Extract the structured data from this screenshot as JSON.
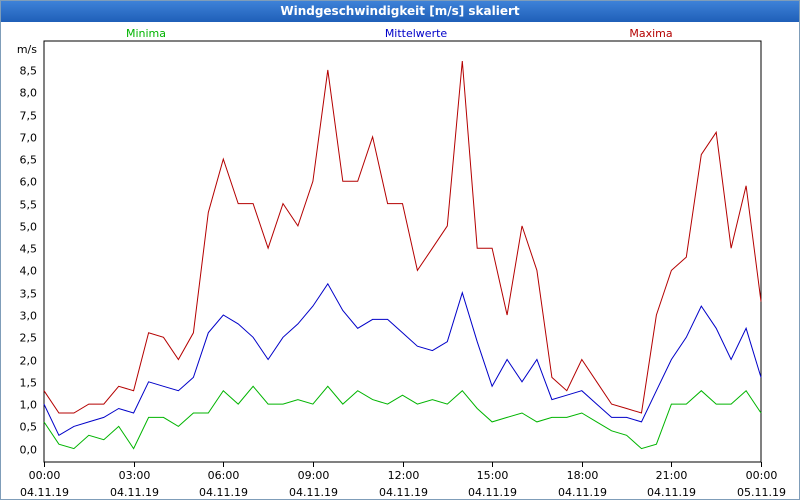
{
  "window": {
    "title": "Windgeschwindigkeit [m/s] skaliert"
  },
  "colors": {
    "min": "#00b400",
    "mean": "#0000c8",
    "max": "#b40000",
    "grid": "#000000"
  },
  "chart_data": {
    "type": "line",
    "title": "Windgeschwindigkeit [m/s] skaliert",
    "ylabel": "m/s",
    "ylim": [
      -0.3,
      9.15
    ],
    "xlim": [
      0,
      24
    ],
    "yticks": [
      "0,0",
      "0,5",
      "1,0",
      "1,5",
      "2,0",
      "2,5",
      "3,0",
      "3,5",
      "4,0",
      "4,5",
      "5,0",
      "5,5",
      "6,0",
      "6,5",
      "7,0",
      "7,5",
      "8,0",
      "8,5"
    ],
    "ytick_values": [
      0,
      0.5,
      1,
      1.5,
      2,
      2.5,
      3,
      3.5,
      4,
      4.5,
      5,
      5.5,
      6,
      6.5,
      7,
      7.5,
      8,
      8.5
    ],
    "xtick_times": [
      "00:00",
      "03:00",
      "06:00",
      "09:00",
      "12:00",
      "15:00",
      "18:00",
      "21:00",
      "00:00"
    ],
    "xtick_dates": [
      "04.11.19",
      "04.11.19",
      "04.11.19",
      "04.11.19",
      "04.11.19",
      "04.11.19",
      "04.11.19",
      "04.11.19",
      "05.11.19"
    ],
    "xtick_values": [
      0,
      3,
      6,
      9,
      12,
      15,
      18,
      21,
      24
    ],
    "grid": true,
    "legend_position": "top",
    "series": [
      {
        "name": "Minima",
        "color": "#00b400",
        "x": [
          0,
          0.5,
          1,
          1.5,
          2,
          2.5,
          3,
          3.5,
          4,
          4.5,
          5,
          5.5,
          6,
          6.5,
          7,
          7.5,
          8,
          8.5,
          9,
          9.5,
          10,
          10.5,
          11,
          11.5,
          12,
          12.5,
          13,
          13.5,
          14,
          14.5,
          15,
          15.5,
          16,
          16.5,
          17,
          17.5,
          18,
          18.5,
          19,
          19.5,
          20,
          20.5,
          21,
          21.5,
          22,
          22.5,
          23,
          23.5,
          24
        ],
        "values": [
          0.6,
          0.1,
          0.0,
          0.3,
          0.2,
          0.5,
          0.0,
          0.7,
          0.7,
          0.5,
          0.8,
          0.8,
          1.3,
          1.0,
          1.4,
          1.0,
          1.0,
          1.1,
          1.0,
          1.4,
          1.0,
          1.3,
          1.1,
          1.0,
          1.2,
          1.0,
          1.1,
          1.0,
          1.3,
          0.9,
          0.6,
          0.7,
          0.8,
          0.6,
          0.7,
          0.7,
          0.8,
          0.6,
          0.4,
          0.3,
          0.0,
          0.1,
          1.0,
          1.0,
          1.3,
          1.0,
          1.0,
          1.3,
          0.8
        ]
      },
      {
        "name": "Mittelwerte",
        "color": "#0000c8",
        "x": [
          0,
          0.5,
          1,
          1.5,
          2,
          2.5,
          3,
          3.5,
          4,
          4.5,
          5,
          5.5,
          6,
          6.5,
          7,
          7.5,
          8,
          8.5,
          9,
          9.5,
          10,
          10.5,
          11,
          11.5,
          12,
          12.5,
          13,
          13.5,
          14,
          14.5,
          15,
          15.5,
          16,
          16.5,
          17,
          17.5,
          18,
          18.5,
          19,
          19.5,
          20,
          20.5,
          21,
          21.5,
          22,
          22.5,
          23,
          23.5,
          24
        ],
        "values": [
          1.0,
          0.3,
          0.5,
          0.6,
          0.7,
          0.9,
          0.8,
          1.5,
          1.4,
          1.3,
          1.6,
          2.6,
          3.0,
          2.8,
          2.5,
          2.0,
          2.5,
          2.8,
          3.2,
          3.7,
          3.1,
          2.7,
          2.9,
          2.9,
          2.6,
          2.3,
          2.2,
          2.4,
          3.5,
          2.4,
          1.4,
          2.0,
          1.5,
          2.0,
          1.1,
          1.2,
          1.3,
          1.0,
          0.7,
          0.7,
          0.6,
          1.3,
          2.0,
          2.5,
          3.2,
          2.7,
          2.0,
          2.7,
          1.6
        ]
      },
      {
        "name": "Maxima",
        "color": "#b40000",
        "x": [
          0,
          0.5,
          1,
          1.5,
          2,
          2.5,
          3,
          3.5,
          4,
          4.5,
          5,
          5.5,
          6,
          6.5,
          7,
          7.5,
          8,
          8.5,
          9,
          9.5,
          10,
          10.5,
          11,
          11.5,
          12,
          12.5,
          13,
          13.5,
          14,
          14.5,
          15,
          15.5,
          16,
          16.5,
          17,
          17.5,
          18,
          18.5,
          19,
          19.5,
          20,
          20.5,
          21,
          21.5,
          22,
          22.5,
          23,
          23.5,
          24
        ],
        "values": [
          1.3,
          0.8,
          0.8,
          1.0,
          1.0,
          1.4,
          1.3,
          2.6,
          2.5,
          2.0,
          2.6,
          5.3,
          6.5,
          5.5,
          5.5,
          4.5,
          5.5,
          5.0,
          6.0,
          8.5,
          6.0,
          6.0,
          7.0,
          5.5,
          5.5,
          4.0,
          4.5,
          5.0,
          8.7,
          4.5,
          4.5,
          3.0,
          5.0,
          4.0,
          1.6,
          1.3,
          2.0,
          1.5,
          1.0,
          0.9,
          0.8,
          3.0,
          4.0,
          4.3,
          6.6,
          7.1,
          4.5,
          5.9,
          3.3
        ]
      }
    ]
  }
}
